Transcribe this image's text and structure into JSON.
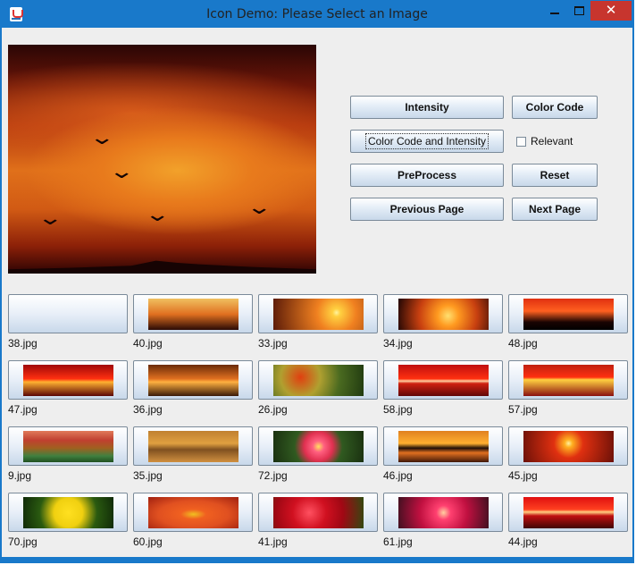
{
  "window": {
    "title": "Icon Demo: Please Select an Image",
    "close_glyph": "✕"
  },
  "main_image": {
    "description_icon": "sunset-birds"
  },
  "buttons": {
    "intensity": "Intensity",
    "color_code": "Color Code",
    "color_code_and_intensity": "Color Code and Intensity",
    "relevant": "Relevant",
    "preprocess": "PreProcess",
    "reset": "Reset",
    "previous_page": "Previous Page",
    "next_page": "Next Page"
  },
  "relevant_checked": false,
  "thumbnails": [
    {
      "label": "38.jpg",
      "image": "sunset-birds"
    },
    {
      "label": "40.jpg",
      "image": "flock"
    },
    {
      "label": "33.jpg",
      "image": "cactus"
    },
    {
      "label": "34.jpg",
      "image": "treesun"
    },
    {
      "label": "48.jpg",
      "image": "forest"
    },
    {
      "label": "47.jpg",
      "image": "redsea"
    },
    {
      "label": "36.jpg",
      "image": "orangesea"
    },
    {
      "label": "26.jpg",
      "image": "foliage"
    },
    {
      "label": "58.jpg",
      "image": "redhorizon"
    },
    {
      "label": "57.jpg",
      "image": "calmsea"
    },
    {
      "label": "9.jpg",
      "image": "field"
    },
    {
      "label": "35.jpg",
      "image": "clouds"
    },
    {
      "label": "72.jpg",
      "image": "redflower"
    },
    {
      "label": "46.jpg",
      "image": "rocks"
    },
    {
      "label": "45.jpg",
      "image": "redsun"
    },
    {
      "label": "70.jpg",
      "image": "yellowflower"
    },
    {
      "label": "60.jpg",
      "image": "orangeflower"
    },
    {
      "label": "41.jpg",
      "image": "berries"
    },
    {
      "label": "61.jpg",
      "image": "pinkflower"
    },
    {
      "label": "44.jpg",
      "image": "boat"
    }
  ],
  "colors": {
    "titlebar": "#1979ca",
    "close_button": "#c7352e",
    "panel": "#eeeeee"
  }
}
